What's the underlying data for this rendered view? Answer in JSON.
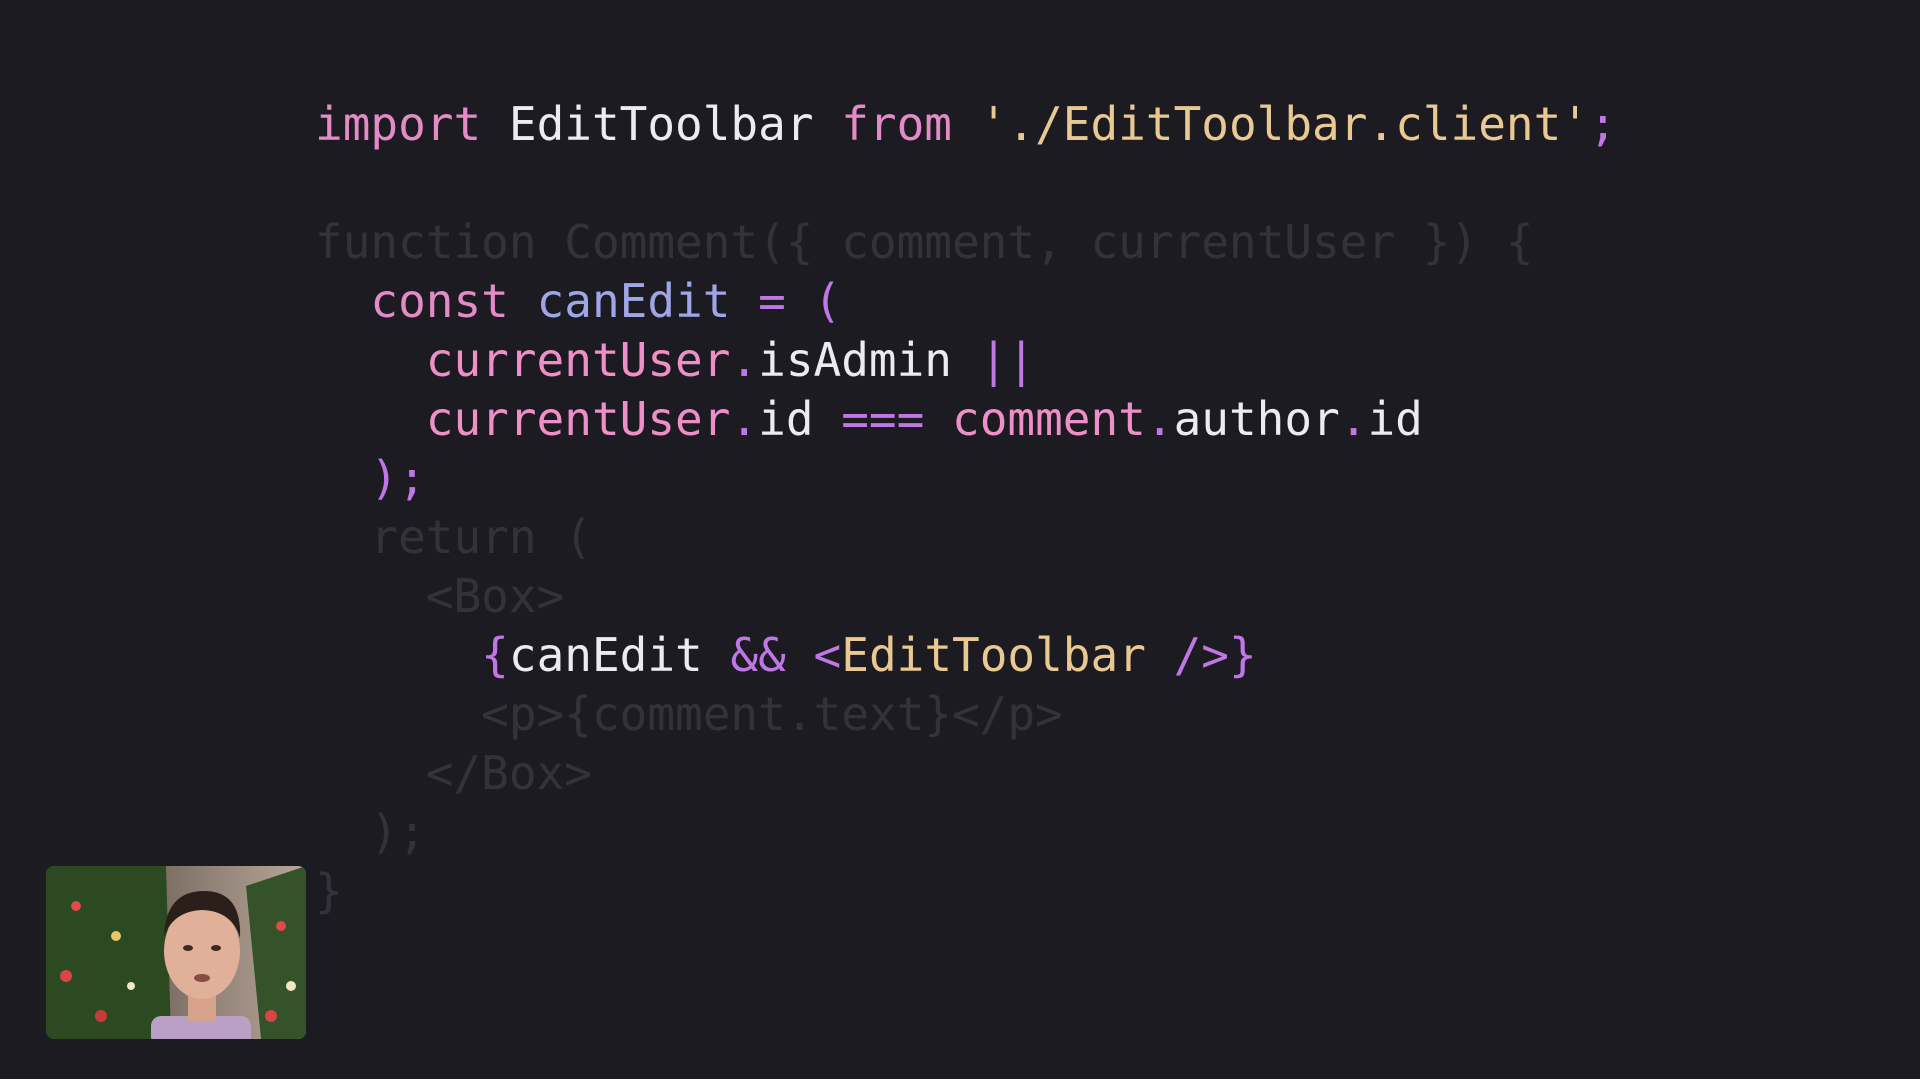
{
  "code": {
    "lines": [
      {
        "dim": false,
        "tokens": [
          {
            "t": "import",
            "c": "kw"
          },
          {
            "t": " ",
            "c": "plain"
          },
          {
            "t": "EditToolbar",
            "c": "plain"
          },
          {
            "t": " ",
            "c": "plain"
          },
          {
            "t": "from",
            "c": "kw"
          },
          {
            "t": " ",
            "c": "plain"
          },
          {
            "t": "'./EditToolbar.client'",
            "c": "str"
          },
          {
            "t": ";",
            "c": "op"
          }
        ]
      },
      {
        "dim": false,
        "tokens": []
      },
      {
        "dim": true,
        "tokens": [
          {
            "t": "function Comment({ comment, currentUser }) {",
            "c": "plain"
          }
        ]
      },
      {
        "dim": false,
        "tokens": [
          {
            "t": "  ",
            "c": "plain"
          },
          {
            "t": "const",
            "c": "kw"
          },
          {
            "t": " ",
            "c": "plain"
          },
          {
            "t": "canEdit",
            "c": "fn"
          },
          {
            "t": " ",
            "c": "plain"
          },
          {
            "t": "=",
            "c": "op"
          },
          {
            "t": " ",
            "c": "plain"
          },
          {
            "t": "(",
            "c": "op"
          }
        ]
      },
      {
        "dim": false,
        "tokens": [
          {
            "t": "    ",
            "c": "plain"
          },
          {
            "t": "currentUser",
            "c": "var"
          },
          {
            "t": ".",
            "c": "op"
          },
          {
            "t": "isAdmin",
            "c": "plain"
          },
          {
            "t": " ",
            "c": "plain"
          },
          {
            "t": "||",
            "c": "op"
          }
        ]
      },
      {
        "dim": false,
        "tokens": [
          {
            "t": "    ",
            "c": "plain"
          },
          {
            "t": "currentUser",
            "c": "var"
          },
          {
            "t": ".",
            "c": "op"
          },
          {
            "t": "id",
            "c": "plain"
          },
          {
            "t": " ",
            "c": "plain"
          },
          {
            "t": "===",
            "c": "op"
          },
          {
            "t": " ",
            "c": "plain"
          },
          {
            "t": "comment",
            "c": "var"
          },
          {
            "t": ".",
            "c": "op"
          },
          {
            "t": "author",
            "c": "plain"
          },
          {
            "t": ".",
            "c": "op"
          },
          {
            "t": "id",
            "c": "plain"
          }
        ]
      },
      {
        "dim": false,
        "tokens": [
          {
            "t": "  ",
            "c": "plain"
          },
          {
            "t": ");",
            "c": "op"
          }
        ]
      },
      {
        "dim": true,
        "tokens": [
          {
            "t": "  return (",
            "c": "plain"
          }
        ]
      },
      {
        "dim": true,
        "tokens": [
          {
            "t": "    <Box>",
            "c": "plain"
          }
        ]
      },
      {
        "dim": false,
        "tokens": [
          {
            "t": "      ",
            "c": "plain"
          },
          {
            "t": "{",
            "c": "op"
          },
          {
            "t": "canEdit",
            "c": "plain"
          },
          {
            "t": " ",
            "c": "plain"
          },
          {
            "t": "&&",
            "c": "op"
          },
          {
            "t": " ",
            "c": "plain"
          },
          {
            "t": "<",
            "c": "op"
          },
          {
            "t": "EditToolbar",
            "c": "str"
          },
          {
            "t": " ",
            "c": "plain"
          },
          {
            "t": "/>",
            "c": "op"
          },
          {
            "t": "}",
            "c": "op"
          }
        ]
      },
      {
        "dim": true,
        "tokens": [
          {
            "t": "      <p>{comment.text}</p>",
            "c": "plain"
          }
        ]
      },
      {
        "dim": true,
        "tokens": [
          {
            "t": "    </Box>",
            "c": "plain"
          }
        ]
      },
      {
        "dim": true,
        "tokens": [
          {
            "t": "  );",
            "c": "plain"
          }
        ]
      },
      {
        "dim": true,
        "tokens": [
          {
            "t": "}",
            "c": "plain"
          }
        ]
      }
    ]
  },
  "colors": {
    "background": "#1c1b22",
    "keyword": "#e38bc6",
    "function": "#9fa6e8",
    "operator": "#c077e6",
    "string": "#e9c892",
    "variable": "#ef8fc8",
    "text": "#ecebf2"
  },
  "webcam": {
    "subject": "presenter-webcam"
  }
}
